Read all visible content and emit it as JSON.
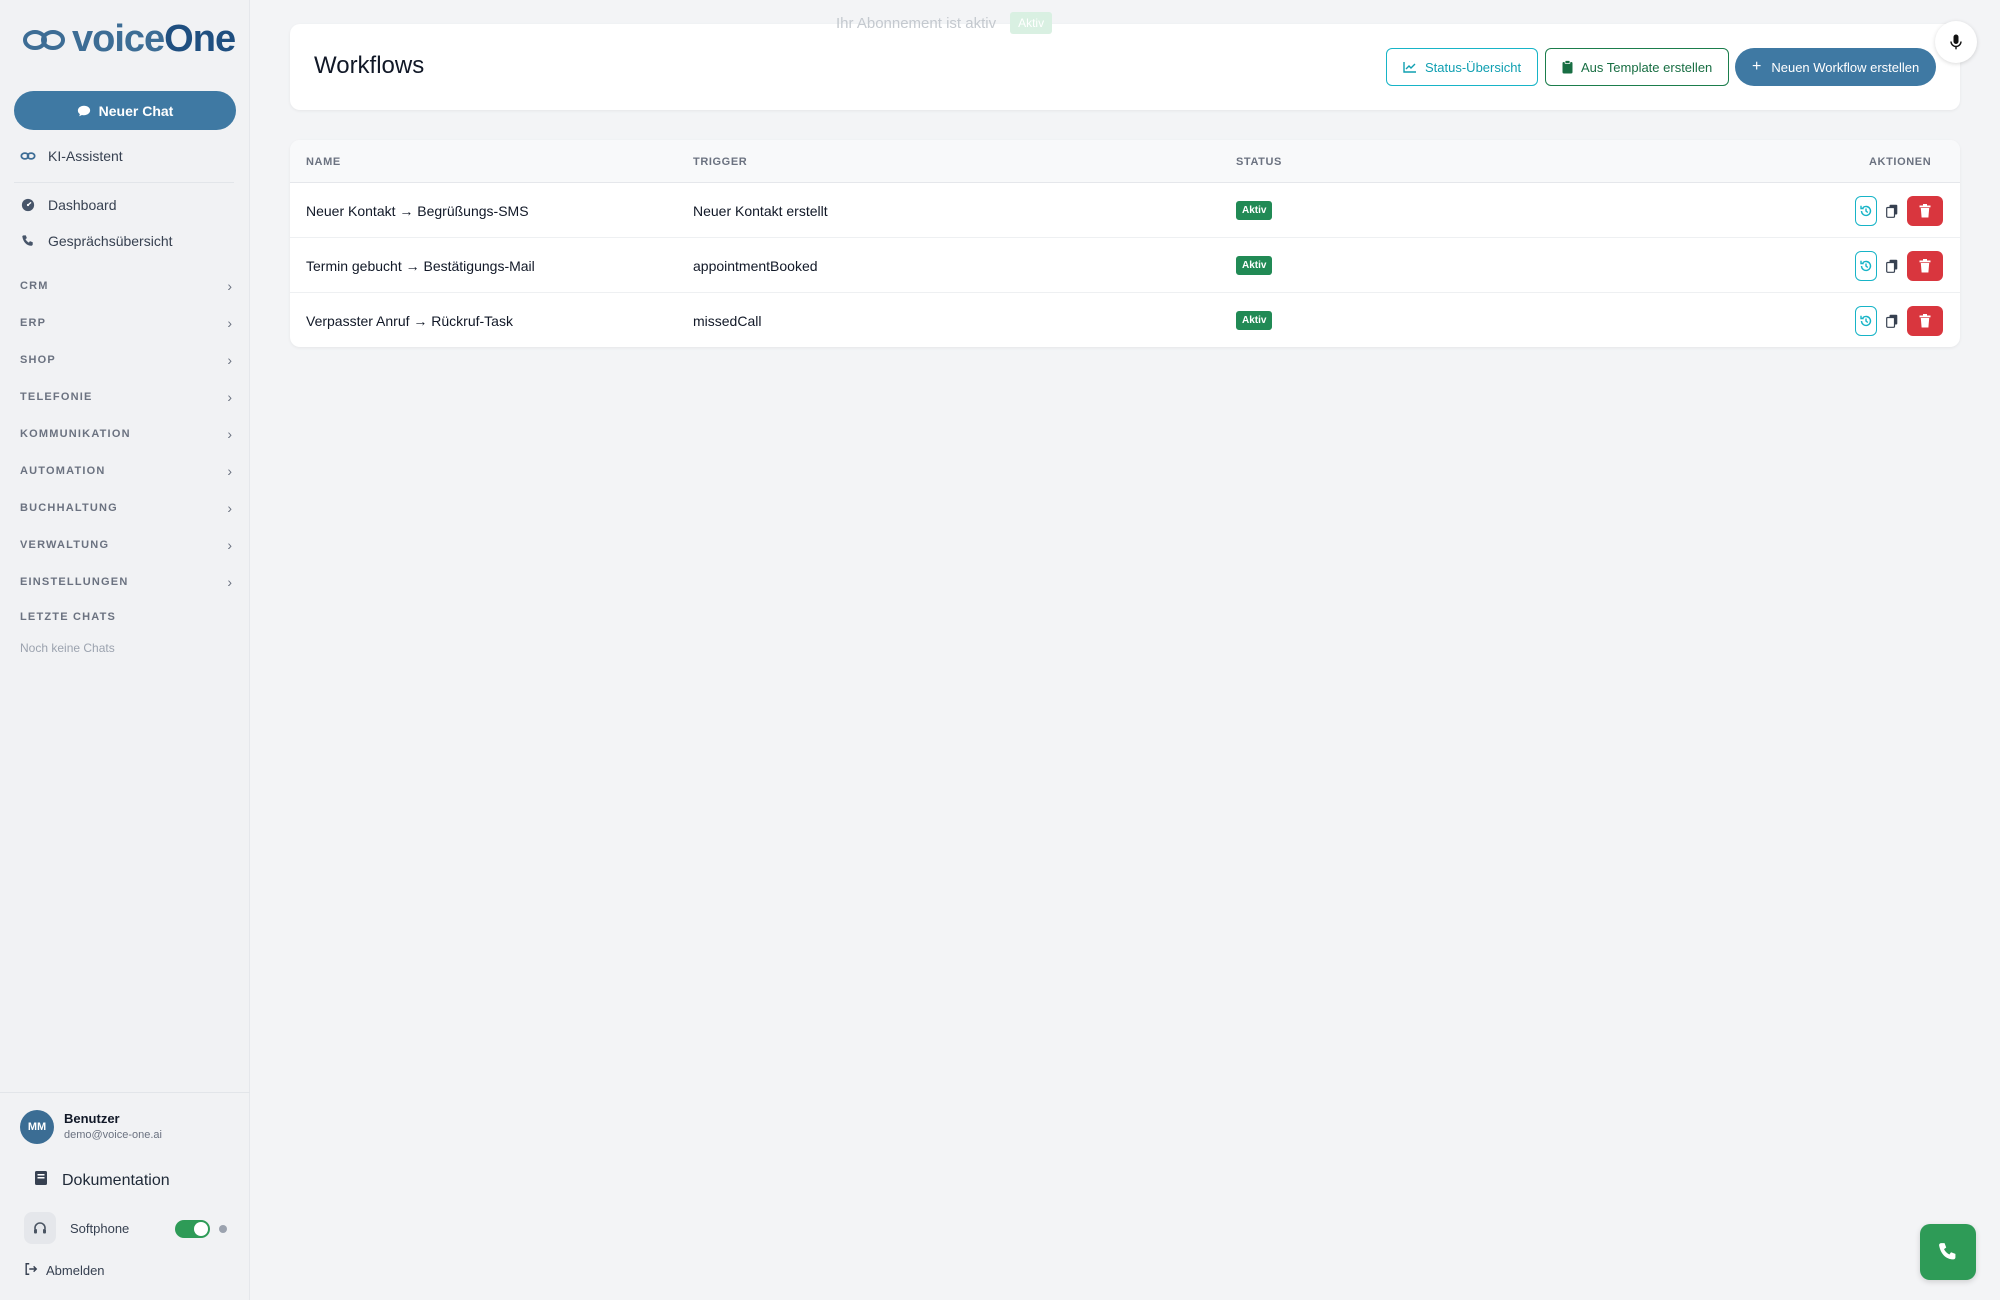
{
  "app": {
    "logo_text_a": "voice",
    "logo_text_b": "One"
  },
  "sidebar": {
    "new_chat_label": "Neuer Chat",
    "assistant_label": "KI-Assistent",
    "items": [
      {
        "label": "Dashboard",
        "icon": "gauge-icon"
      },
      {
        "label": "Gesprächsübersicht",
        "icon": "phone-icon"
      }
    ],
    "sections": [
      "CRM",
      "ERP",
      "SHOP",
      "TELEFONIE",
      "KOMMUNIKATION",
      "AUTOMATION",
      "BUCHHALTUNG",
      "VERWALTUNG",
      "EINSTELLUNGEN"
    ],
    "recent_chats_heading": "LETZTE CHATS",
    "recent_chats_empty": "Noch keine Chats",
    "user": {
      "initials": "MM",
      "name": "Benutzer",
      "email": "demo@voice-one.ai"
    },
    "documentation_label": "Dokumentation",
    "softphone_label": "Softphone",
    "softphone_enabled": true,
    "logout_label": "Abmelden"
  },
  "header": {
    "title": "Workflows",
    "subscription_text": "Ihr Abonnement ist aktiv",
    "subscription_badge": "Aktiv",
    "btn_status": "Status-Übersicht",
    "btn_template": "Aus Template erstellen",
    "btn_new": "Neuen Workflow erstellen"
  },
  "table": {
    "columns": {
      "name": "NAME",
      "trigger": "TRIGGER",
      "status": "STATUS",
      "actions": "AKTIONEN"
    },
    "rows": [
      {
        "name": "Neuer Kontakt → Begrüßungs-SMS",
        "trigger": "Neuer Kontakt erstellt",
        "status": "Aktiv"
      },
      {
        "name": "Termin gebucht → Bestätigungs-Mail",
        "trigger": "appointmentBooked",
        "status": "Aktiv"
      },
      {
        "name": "Verpasster Anruf → Rückruf-Task",
        "trigger": "missedCall",
        "status": "Aktiv"
      }
    ]
  },
  "colors": {
    "primary": "#3f79a3",
    "success": "#218a55",
    "danger": "#d9363e",
    "teal": "#17b4c7"
  }
}
